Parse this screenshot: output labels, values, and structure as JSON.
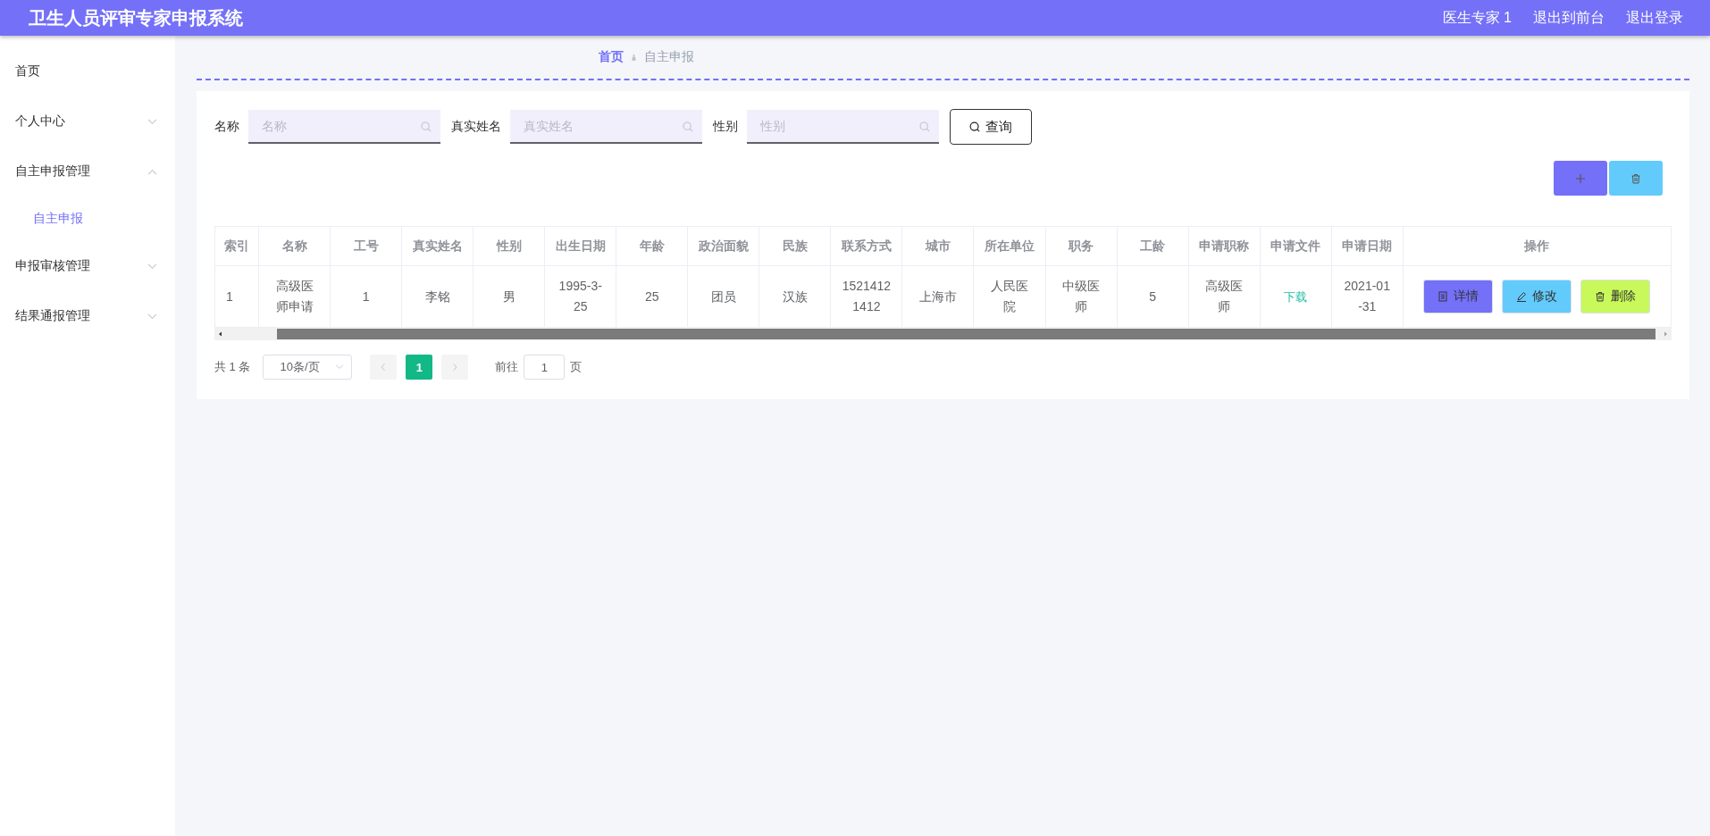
{
  "header": {
    "title": "卫生人员评审专家申报系统",
    "links": [
      "医生专家 1",
      "退出到前台",
      "退出登录"
    ]
  },
  "sidebar": {
    "items": [
      {
        "label": "首页",
        "kind": "link"
      },
      {
        "label": "个人中心",
        "kind": "group",
        "expanded": false
      },
      {
        "label": "自主申报管理",
        "kind": "group",
        "expanded": true,
        "children": [
          {
            "label": "自主申报",
            "selected": true
          }
        ]
      },
      {
        "label": "申报审核管理",
        "kind": "group",
        "expanded": false
      },
      {
        "label": "结果通报管理",
        "kind": "group",
        "expanded": false
      }
    ]
  },
  "breadcrumb": [
    "首页",
    "自主申报"
  ],
  "search": {
    "fields": [
      {
        "label": "名称",
        "placeholder": "名称"
      },
      {
        "label": "真实姓名",
        "placeholder": "真实姓名"
      },
      {
        "label": "性别",
        "placeholder": "性别"
      }
    ],
    "button": "查询"
  },
  "table": {
    "columns": [
      "索引",
      "名称",
      "工号",
      "真实姓名",
      "性别",
      "出生日期",
      "年龄",
      "政治面貌",
      "民族",
      "联系方式",
      "城市",
      "所在单位",
      "职务",
      "工龄",
      "申请职称",
      "申请文件",
      "申请日期",
      "操作"
    ],
    "rows": [
      {
        "cells": [
          {
            "kind": "text",
            "text": "1"
          },
          {
            "kind": "text",
            "text": "高级医师申请"
          },
          {
            "kind": "text",
            "text": "1"
          },
          {
            "kind": "text",
            "text": "李铭"
          },
          {
            "kind": "text",
            "text": "男"
          },
          {
            "kind": "text",
            "text": "1995-3-25"
          },
          {
            "kind": "text",
            "text": "25"
          },
          {
            "kind": "text",
            "text": "团员"
          },
          {
            "kind": "text",
            "text": "汉族"
          },
          {
            "kind": "text",
            "text": "15214121412"
          },
          {
            "kind": "text",
            "text": "上海市"
          },
          {
            "kind": "text",
            "text": "人民医院"
          },
          {
            "kind": "text",
            "text": "中级医师"
          },
          {
            "kind": "text",
            "text": "5"
          },
          {
            "kind": "text",
            "text": "高级医师"
          },
          {
            "kind": "link",
            "text": "下载"
          },
          {
            "kind": "text",
            "text": "2021-01-31"
          },
          {
            "kind": "actions",
            "buttons": [
              {
                "kind": "detail",
                "label": "详情"
              },
              {
                "kind": "edit",
                "label": "修改"
              },
              {
                "kind": "delete",
                "label": "删除"
              }
            ]
          }
        ]
      }
    ]
  },
  "pagination": {
    "total": "共 1 条",
    "page_size": "10条/页",
    "pages": [
      {
        "label": "1",
        "selected": true
      }
    ],
    "goto_label": "前往",
    "goto_value": "1",
    "goto_unit": "页"
  }
}
